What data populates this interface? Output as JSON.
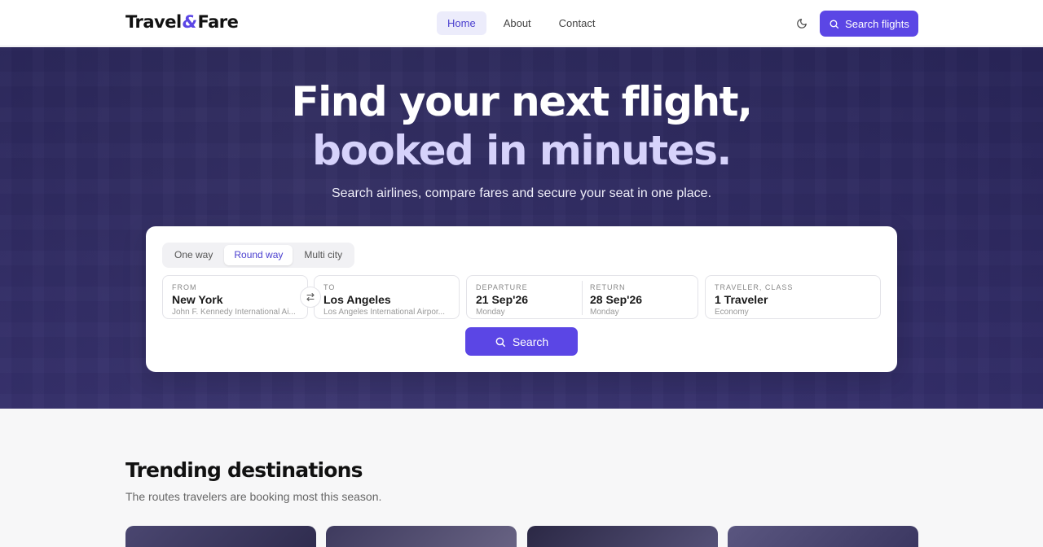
{
  "nav": {
    "logo_part1": "Travel",
    "logo_amp": "&",
    "logo_part2": "Fare",
    "links": [
      "Home",
      "About",
      "Contact"
    ],
    "active_link": "Home",
    "cta_label": "Search flights"
  },
  "hero": {
    "title_line1": "Find your next flight,",
    "title_line2": "booked in minutes.",
    "subtitle": "Search airlines, compare fares and secure your seat in one place."
  },
  "search": {
    "trip_types": [
      "One way",
      "Round way",
      "Multi city"
    ],
    "selected_trip_type": "Round way",
    "from": {
      "label": "FROM",
      "value": "New York",
      "airport": "John F. Kennedy International Ai..."
    },
    "to": {
      "label": "TO",
      "value": "Los Angeles",
      "airport": "Los Angeles International Airpor..."
    },
    "departure": {
      "label": "DEPARTURE",
      "value": "21 Sep'26",
      "day": "Monday"
    },
    "return": {
      "label": "RETURN",
      "value": "28 Sep'26",
      "day": "Monday"
    },
    "traveler": {
      "label": "TRAVELER, CLASS",
      "value": "1 Traveler",
      "class": "Economy"
    },
    "button_label": "Search"
  },
  "trending": {
    "title": "Trending destinations",
    "subtitle": "The routes travelers are booking most this season."
  },
  "colors": {
    "accent": "#5b46e5",
    "accent_soft": "#d6d2fb"
  },
  "icons": {
    "theme": "moon-icon",
    "search": "search-icon",
    "swap": "swap-icon"
  }
}
